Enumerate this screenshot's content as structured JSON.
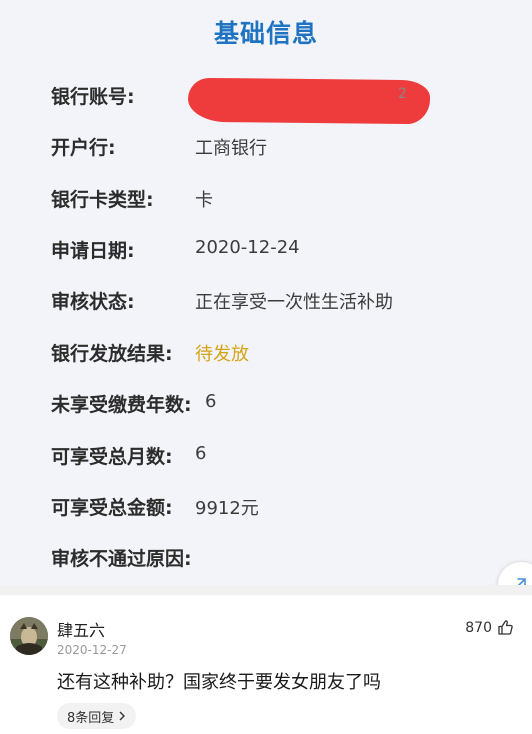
{
  "info": {
    "title": "基础信息",
    "rows": [
      {
        "label": "银行账号:",
        "value": ""
      },
      {
        "label": "开户行:",
        "value": "工商银行"
      },
      {
        "label": "银行卡类型:",
        "value": "卡"
      },
      {
        "label": "申请日期:",
        "value": "2020-12-24"
      },
      {
        "label": "审核状态:",
        "value": "正在享受一次性生活补助"
      },
      {
        "label": "银行发放结果:",
        "value": "待发放"
      },
      {
        "label": "未享受缴费年数:",
        "value": "6"
      },
      {
        "label": "可享受总月数:",
        "value": "6"
      },
      {
        "label": "可享受总金额:",
        "value": "9912元"
      },
      {
        "label": "审核不通过原因:",
        "value": ""
      }
    ],
    "redaction_tail": "2"
  },
  "comment": {
    "author": "肆五六",
    "date": "2020-12-27",
    "likes": "870",
    "text": "还有这种补助？国家终于要发女朋友了吗",
    "replies_label": "8条回复"
  },
  "colors": {
    "title_blue": "#1f74c2",
    "pending_yellow": "#d6a417",
    "redaction_red": "#ee3b3b"
  }
}
